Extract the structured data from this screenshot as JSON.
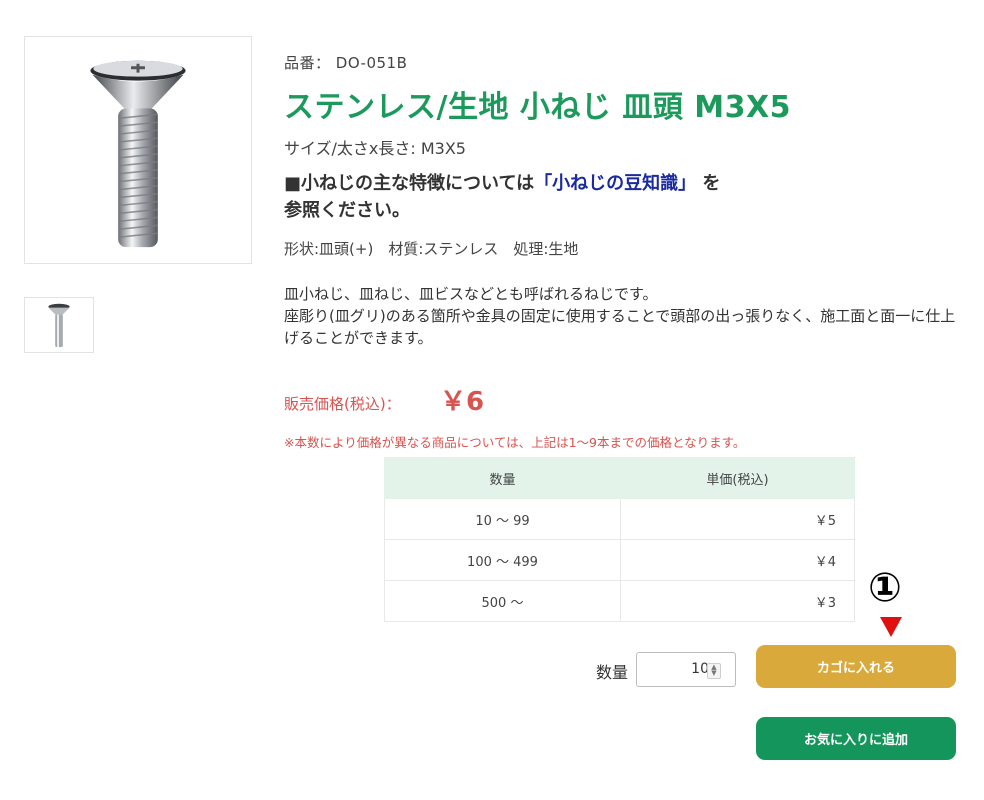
{
  "product": {
    "code": "品番： DO-051B",
    "title": "ステンレス/生地 小ねじ 皿頭 M3X5",
    "size": "サイズ/太さx長さ: M3X5",
    "feature_prefix": "■小ねじの主な特徴については",
    "feature_link": "「小ねじの豆知識」",
    "feature_suffix_line1": "を",
    "feature_suffix_line2": "参照ください。",
    "spec": "形状:皿頭(+)　材質:ステンレス　処理:生地",
    "description_line1": "皿小ねじ、皿ねじ、皿ビスなどとも呼ばれるねじです。",
    "description_line2": "座彫り(皿グリ)のある箇所や金具の固定に使用することで頭部の出っ張りなく、施工面と面一に仕上げることができます。",
    "image_icon": "screw-image",
    "thumbnail_icon": "screw-thumbnail"
  },
  "price": {
    "label": "販売価格(税込)：",
    "value": "￥6",
    "note": "※本数により価格が異なる商品については、上記は1〜9本までの価格となります。"
  },
  "price_table": {
    "headers": [
      "数量",
      "単価(税込)"
    ],
    "rows": [
      {
        "qty": "10 〜 99",
        "price": "￥5"
      },
      {
        "qty": "100 〜 499",
        "price": "￥4"
      },
      {
        "qty": "500 〜",
        "price": "￥3"
      }
    ]
  },
  "annotation": {
    "marker": "①",
    "arrow_color": "#e01010"
  },
  "purchase": {
    "qty_label": "数量",
    "qty_value": "10",
    "cart_button": "カゴに入れる",
    "favorite_button": "お気に入りに追加"
  },
  "colors": {
    "title_green": "#1b9a5c",
    "price_red": "#d9534f",
    "cart_gold": "#d9a93b",
    "fav_green": "#13955c",
    "link_blue": "#1a2aa0"
  }
}
